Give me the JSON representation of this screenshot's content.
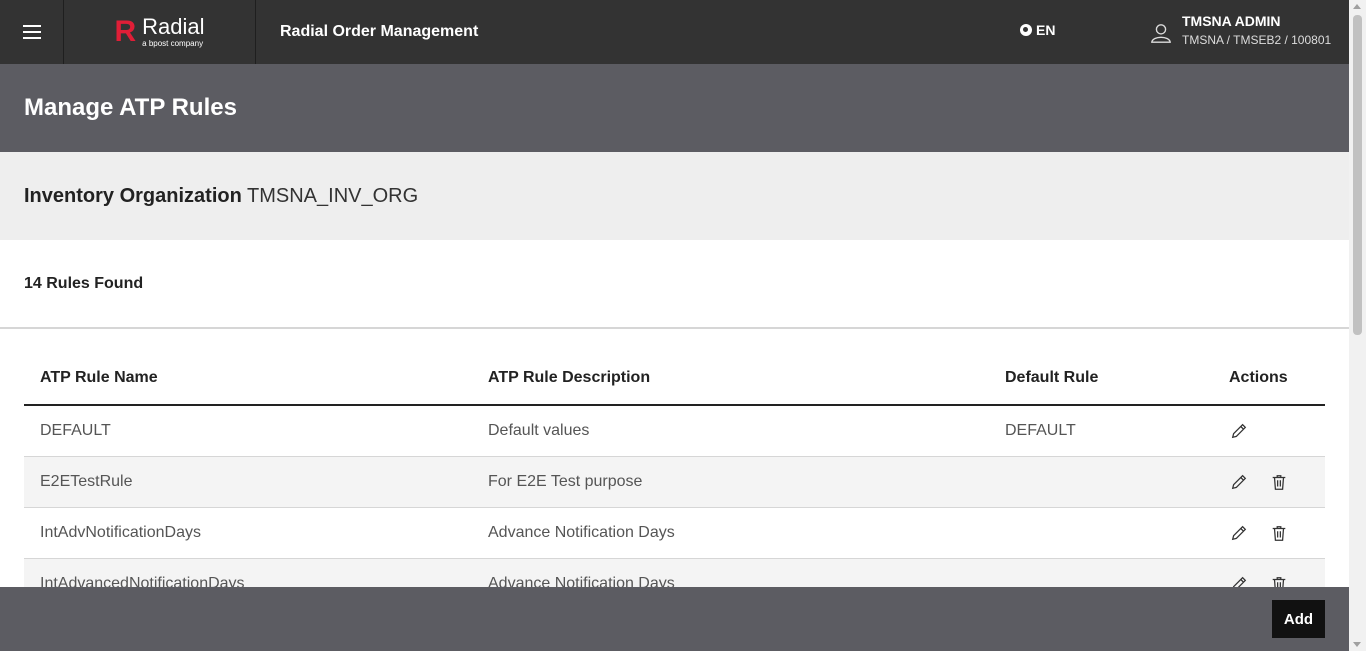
{
  "header": {
    "brand_mark": "R",
    "brand_name": "Radial",
    "brand_sub": "a bpost company",
    "app_title": "Radial Order Management",
    "language": "EN",
    "user_name": "TMSNA ADMIN",
    "user_context": "TMSNA / TMSEB2 / 100801"
  },
  "page": {
    "title": "Manage ATP Rules"
  },
  "org": {
    "label": "Inventory Organization",
    "value": "TMSNA_INV_ORG"
  },
  "results": {
    "count_text": "14 Rules Found"
  },
  "table": {
    "headers": {
      "name": "ATP Rule Name",
      "description": "ATP Rule Description",
      "default_rule": "Default Rule",
      "actions": "Actions"
    },
    "rows": [
      {
        "name": "DEFAULT",
        "description": "Default values",
        "default_rule": "DEFAULT"
      },
      {
        "name": "E2ETestRule",
        "description": "For E2E Test purpose",
        "default_rule": ""
      },
      {
        "name": "IntAdvNotificationDays",
        "description": "Advance Notification Days",
        "default_rule": ""
      },
      {
        "name": "IntAdvancedNotificationDays",
        "description": "Advance Notification Days",
        "default_rule": ""
      }
    ]
  },
  "footer": {
    "add_label": "Add"
  }
}
